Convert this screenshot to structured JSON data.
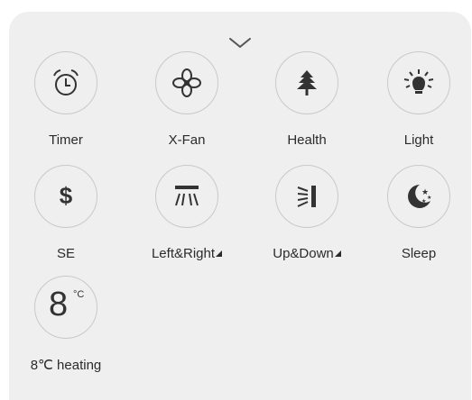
{
  "panel": {
    "collapse_icon": "chevron-down-icon",
    "buttons": [
      {
        "id": "timer",
        "label": "Timer",
        "icon": "alarm-clock-icon",
        "has_submenu": false
      },
      {
        "id": "xfan",
        "label": "X-Fan",
        "icon": "fan-icon",
        "has_submenu": false
      },
      {
        "id": "health",
        "label": "Health",
        "icon": "tree-icon",
        "has_submenu": false
      },
      {
        "id": "light",
        "label": "Light",
        "icon": "light-bulb-icon",
        "has_submenu": false
      },
      {
        "id": "se",
        "label": "SE",
        "icon": "dollar-icon",
        "icon_text": "$",
        "has_submenu": false
      },
      {
        "id": "leftright",
        "label": "Left&Right",
        "icon": "horizontal-swing-icon",
        "has_submenu": true
      },
      {
        "id": "updown",
        "label": "Up&Down",
        "icon": "vertical-swing-icon",
        "has_submenu": true
      },
      {
        "id": "sleep",
        "label": "Sleep",
        "icon": "moon-stars-icon",
        "has_submenu": false
      },
      {
        "id": "heating",
        "label": "8℃ heating",
        "icon": "8c-icon",
        "icon_text": "8",
        "icon_sup": "°C",
        "has_submenu": false
      }
    ]
  },
  "colors": {
    "panel_bg": "#efefef",
    "circle_border": "#c9c9c9",
    "icon": "#333333",
    "text": "#2b2b2b"
  }
}
